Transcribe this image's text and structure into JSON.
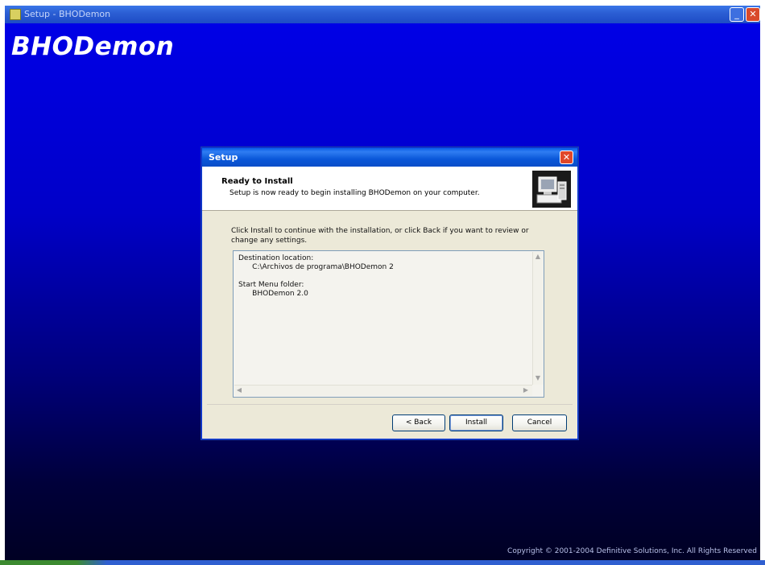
{
  "outer_window": {
    "title": "Setup - BHODemon",
    "app_banner": "BHODemon",
    "copyright": "Copyright © 2001-2004 Definitive Solutions, Inc. All Rights Reserved"
  },
  "dialog": {
    "title": "Setup",
    "header": {
      "title": "Ready to Install",
      "subtitle": "Setup is now ready to begin installing BHODemon on your computer."
    },
    "body_text": "Click Install to continue with the installation, or click Back if you want to review or change any settings.",
    "memo_lines": [
      "Destination location:",
      "      C:\\Archivos de programa\\BHODemon 2",
      "",
      "Start Menu folder:",
      "      BHODemon 2.0"
    ],
    "buttons": {
      "back": "< Back",
      "install": "Install",
      "cancel": "Cancel"
    }
  },
  "colors": {
    "backdrop_top": "#0000e6",
    "backdrop_bottom": "#000022",
    "dialog_face": "#ece9d8",
    "titlebar_blue": "#0a57d8",
    "close_red": "#e0472a"
  }
}
